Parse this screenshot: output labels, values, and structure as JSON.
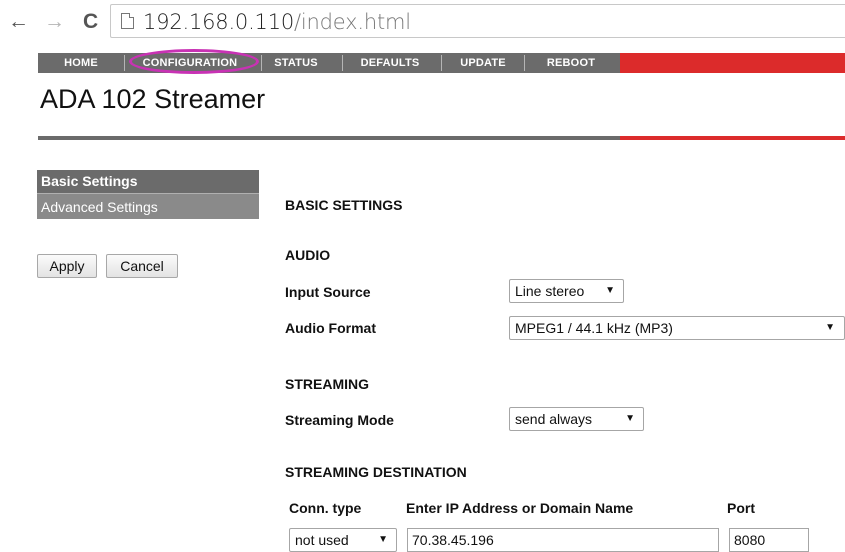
{
  "browser": {
    "url_host": "192.168.0.110",
    "url_path": "/index.html",
    "back_glyph": "←",
    "forward_glyph": "→",
    "reload_glyph": "C"
  },
  "topnav": {
    "items": [
      "HOME",
      "CONFIGURATION",
      "STATUS",
      "DEFAULTS",
      "UPDATE",
      "REBOOT"
    ],
    "active_highlight_color": "#c832b4",
    "bar_color": "#6b6b6b",
    "accent_color": "#dc2b2b"
  },
  "page": {
    "title": "ADA 102 Streamer"
  },
  "sidebar": {
    "items": [
      {
        "label": "Basic Settings",
        "active": true
      },
      {
        "label": "Advanced Settings",
        "active": false
      }
    ],
    "apply_label": "Apply",
    "cancel_label": "Cancel"
  },
  "main": {
    "section_title": "BASIC SETTINGS",
    "audio": {
      "heading": "AUDIO",
      "input_source_label": "Input Source",
      "input_source_value": "Line stereo",
      "audio_format_label": "Audio Format",
      "audio_format_value": "MPEG1 / 44.1 kHz (MP3)"
    },
    "streaming": {
      "heading": "STREAMING",
      "mode_label": "Streaming Mode",
      "mode_value": "send always"
    },
    "destination": {
      "heading": "STREAMING DESTINATION",
      "col_conn_type": "Conn. type",
      "col_address": "Enter IP Address or Domain Name",
      "col_port": "Port",
      "conn_type_value": "not used",
      "address_value": "70.38.45.196",
      "port_value": "8080"
    }
  }
}
